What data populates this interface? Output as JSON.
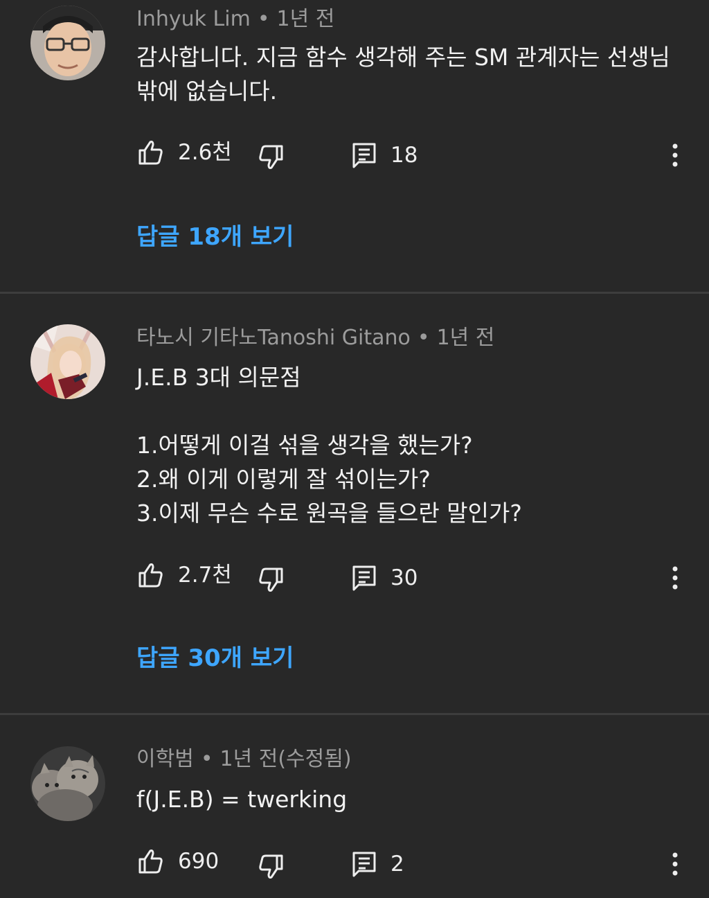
{
  "comments": [
    {
      "author": "Inhyuk Lim",
      "separator": "•",
      "time": "1년 전",
      "text": "감사합니다. 지금 함수 생각해 주는 SM 관계자는 선생님\n밖에 없습니다.",
      "likes": "2.6천",
      "reply_count": "18",
      "view_replies": "답글 18개 보기"
    },
    {
      "author": "타노시 기타노Tanoshi Gitano",
      "separator": "•",
      "time": "1년 전",
      "text": "J.E.B 3대 의문점\n\n1.어떻게 이걸 섞을 생각을 했는가?\n2.왜 이게 이렇게 잘 섞이는가?\n3.이제 무슨 수로 원곡을 들으란 말인가?",
      "likes": "2.7천",
      "reply_count": "30",
      "view_replies": "답글 30개 보기"
    },
    {
      "author": "이학범",
      "separator": "•",
      "time": "1년 전(수정됨)",
      "text": "f(J.E.B) = twerking",
      "likes": "690",
      "reply_count": "2"
    }
  ],
  "icons": {
    "like": "thumbs-up-icon",
    "dislike": "thumbs-down-icon",
    "reply": "comment-icon",
    "more": "more-vertical-icon"
  },
  "colors": {
    "background": "#282828",
    "link": "#3ea6ff",
    "meta_text": "#9c9c9c",
    "body_text": "#f2f2f2",
    "divider": "#3d3d3d"
  }
}
